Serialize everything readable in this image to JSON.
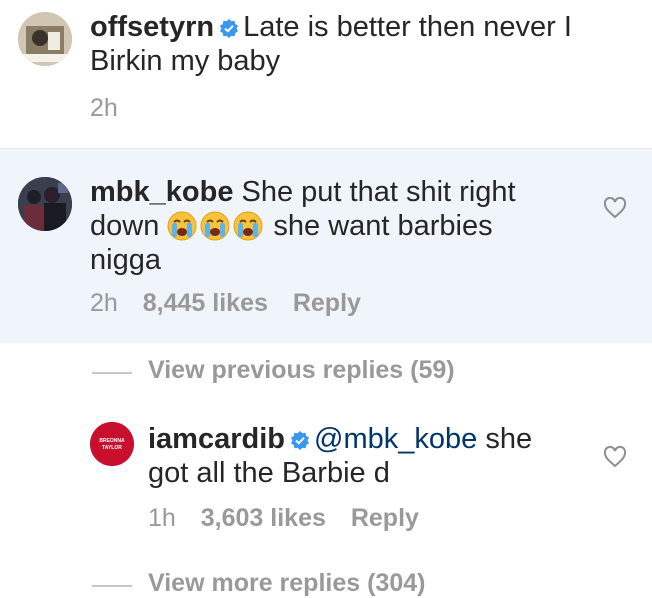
{
  "comments": [
    {
      "username": "offsetyrn",
      "verified": true,
      "text_line1": "Late is better then never I",
      "text_line2": "Birkin my baby",
      "time": "2h"
    },
    {
      "username": "mbk_kobe",
      "text_line1": "She put that shit right",
      "text_line2_start": "down",
      "emoji": [
        "loudly-crying-face",
        "loudly-crying-face",
        "loudly-crying-face"
      ],
      "text_line2_end": "she want barbies",
      "text_line3": "nigga",
      "time": "2h",
      "likes": "8,445 likes",
      "reply_label": "Reply"
    }
  ],
  "view_previous": "View previous replies (59)",
  "reply": {
    "username": "iamcardib",
    "verified": true,
    "mention": "@mbk_kobe",
    "text_line1_end": "she",
    "text_line2": "got all the Barbie d",
    "time": "1h",
    "likes": "3,603 likes",
    "reply_label": "Reply",
    "avatar_text_line1": "BREONNA",
    "avatar_text_line2": "TAYLOR"
  },
  "view_more": "View more replies (304)",
  "colors": {
    "highlight_bg": "#eff5fb",
    "verified_blue": "#3897f0",
    "muted": "#999999",
    "avatar_red": "#c8102e"
  }
}
